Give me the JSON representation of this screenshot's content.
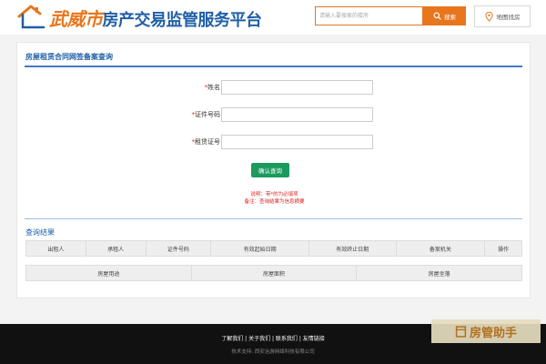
{
  "header": {
    "logo_city": "武威市",
    "logo_rest": "房产交易监管服务平台",
    "search_placeholder": "请输入要搜索的楼房",
    "search_button": "搜索",
    "map_link": "地图找房"
  },
  "query_form": {
    "title": "房屋租赁合同网签备案查询",
    "fields": [
      {
        "label": "姓名",
        "value": ""
      },
      {
        "label": "证件号码",
        "value": ""
      },
      {
        "label": "租赁证号",
        "value": ""
      }
    ],
    "required_mark": "*",
    "submit_label": "确认查询",
    "note_line1": "说明：带*的为必填项",
    "note_line2": "备注：查询结果为信息摘要"
  },
  "results": {
    "title": "查询结果",
    "columns": [
      "出租人",
      "承租人",
      "证件号码",
      "有效起始日期",
      "有效终止日期",
      "备案机关",
      "操作"
    ],
    "sub_columns": [
      "房屋用途",
      "房屋面积",
      "房屋坐落"
    ]
  },
  "footer": {
    "links": [
      "了解我们",
      "关于我们",
      "联系我们",
      "友情链接"
    ],
    "separator": " | ",
    "tech_support": "技术支持: 西安治游网络科技有限公司"
  },
  "watermark": {
    "text": "房管助手"
  },
  "colors": {
    "brand_blue": "#1f5fa6",
    "accent_orange": "#e8761c",
    "confirm_green": "#1a9b5e",
    "required_red": "#e02020"
  }
}
